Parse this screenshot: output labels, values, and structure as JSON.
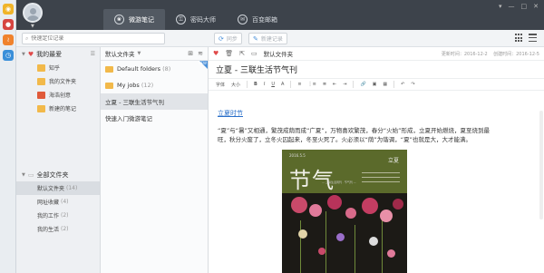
{
  "rail": {
    "icons": [
      "weibo-icon",
      "qq-icon",
      "rss-icon",
      "clock-icon"
    ]
  },
  "header": {
    "tabs": [
      {
        "label": "微游笔记",
        "icon": "butterfly-icon",
        "active": true
      },
      {
        "label": "密码大师",
        "icon": "key-icon",
        "active": false
      },
      {
        "label": "百变邮箱",
        "icon": "mail-icon",
        "active": false
      }
    ],
    "window_controls": [
      "▾",
      "—",
      "□",
      "✕"
    ]
  },
  "toolbar": {
    "search_placeholder": "快速定位记录",
    "sync_label": "同步",
    "new_label": "新建记录"
  },
  "nav": {
    "favorites_title": "我的最爱",
    "favorites_items": [
      {
        "label": "知乎",
        "color": "#f2b94a"
      },
      {
        "label": "我的文件夹",
        "color": "#f2b94a"
      },
      {
        "label": "海浩创意",
        "color": "#e05a3a"
      },
      {
        "label": "新建的笔记",
        "color": "#f2b94a"
      }
    ],
    "all_title": "全部文件夹",
    "all_items": [
      {
        "label": "默认文件夹",
        "count": "(14)",
        "selected": true
      },
      {
        "label": "网址收藏",
        "count": "(4)",
        "selected": false
      },
      {
        "label": "我的工作",
        "count": "(2)",
        "selected": false
      },
      {
        "label": "我的生活",
        "count": "(2)",
        "selected": false
      }
    ]
  },
  "list": {
    "title": "默认文件夹",
    "rows": [
      {
        "label": "Default folders",
        "count": "(8)",
        "folder": true,
        "badge": "NEW"
      },
      {
        "label": "My jobs",
        "count": "(12)",
        "folder": true
      },
      {
        "label": "立夏 - 三联生活节气刊",
        "count": "",
        "folder": false,
        "selected": true
      },
      {
        "label": "快速入门微游笔记",
        "count": "",
        "folder": false
      }
    ]
  },
  "editor": {
    "folder_tag": "默认文件夹",
    "updated": "更新时间：2016-12-2",
    "created": "创建时间：2016-12-5",
    "title": "立夏 - 三联生活节气刊",
    "format_bar": [
      "字体",
      "大小",
      "B",
      "I",
      "U",
      "A",
      "≡",
      "⋮≡",
      "≣",
      "⇤",
      "⇥",
      "🔗",
      "▣",
      "▦",
      "↶",
      "↷"
    ],
    "link_text": "立夏时节",
    "body_lines": [
      "“夏”与“暑”又相通，繁茂成荫而成“广夏”，万物喜欢繁茂，春分“火始”形成，立夏开始燃烧，夏至烧到最",
      "旺，秋分火废了，立冬火囚起来，冬至火死了。火必须以“荫”为谐调，“夏”也就是大，大才能满。"
    ],
    "poster": {
      "date": "2016.5.5",
      "big_title": "节气",
      "corner": "立夏",
      "subtitle": "— 三联生活周刊 · 节气刊 —"
    }
  }
}
